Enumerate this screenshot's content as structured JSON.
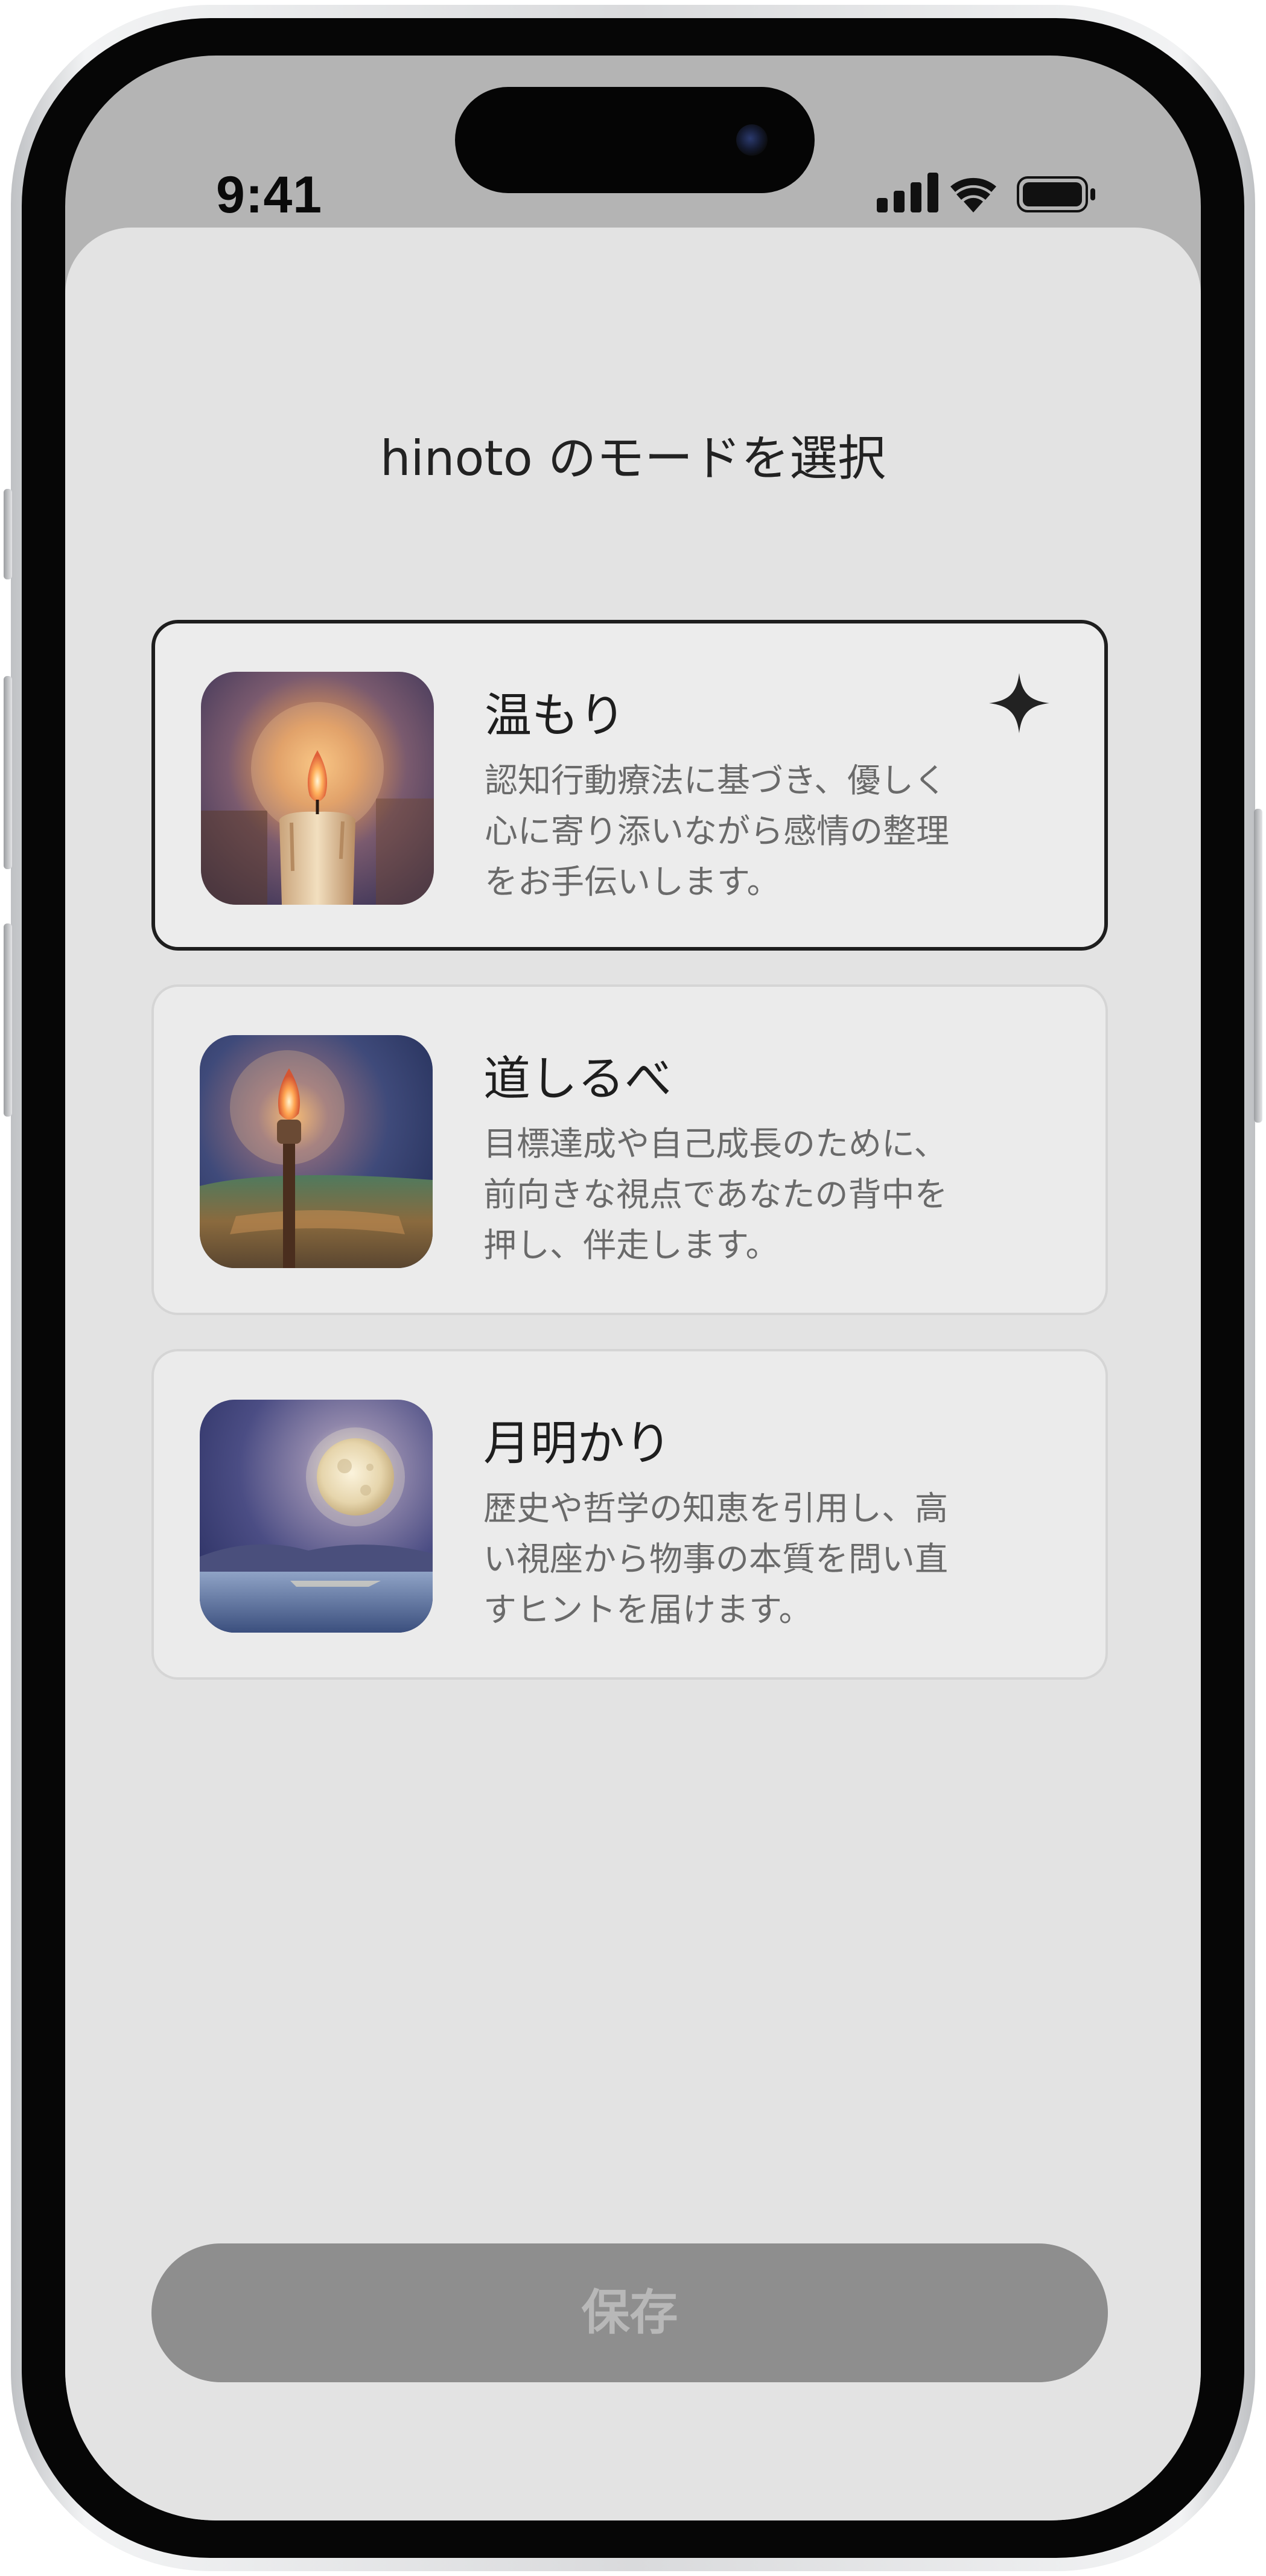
{
  "status_bar": {
    "time": "9:41"
  },
  "sheet": {
    "title": "hinoto のモードを選択"
  },
  "modes": [
    {
      "name": "温もり",
      "description": "認知行動療法に基づき、優しく\n心に寄り添いながら感情の整理\nをお手伝いします。",
      "image": "candle-watercolor",
      "selected": true
    },
    {
      "name": "道しるべ",
      "description": "目標達成や自己成長のために、\n前向きな視点であなたの背中を\n押し、伴走します。",
      "image": "torch-watercolor",
      "selected": false
    },
    {
      "name": "月明かり",
      "description": "歴史や哲学の知恵を引用し、高\nい視座から物事の本質を問い直\nすヒントを届けます。",
      "image": "full-moon-watercolor",
      "selected": false
    }
  ],
  "save_button": {
    "label": "保存",
    "enabled": false
  },
  "colors": {
    "sheet_background": "#e3e3e3",
    "card_background": "#ebebeb",
    "selected_border": "#1e1e1e",
    "save_button_disabled": "#8e8e8e",
    "save_label_disabled": "#b8b8b8"
  },
  "icons": {
    "selected_indicator": "sparkle-icon"
  }
}
